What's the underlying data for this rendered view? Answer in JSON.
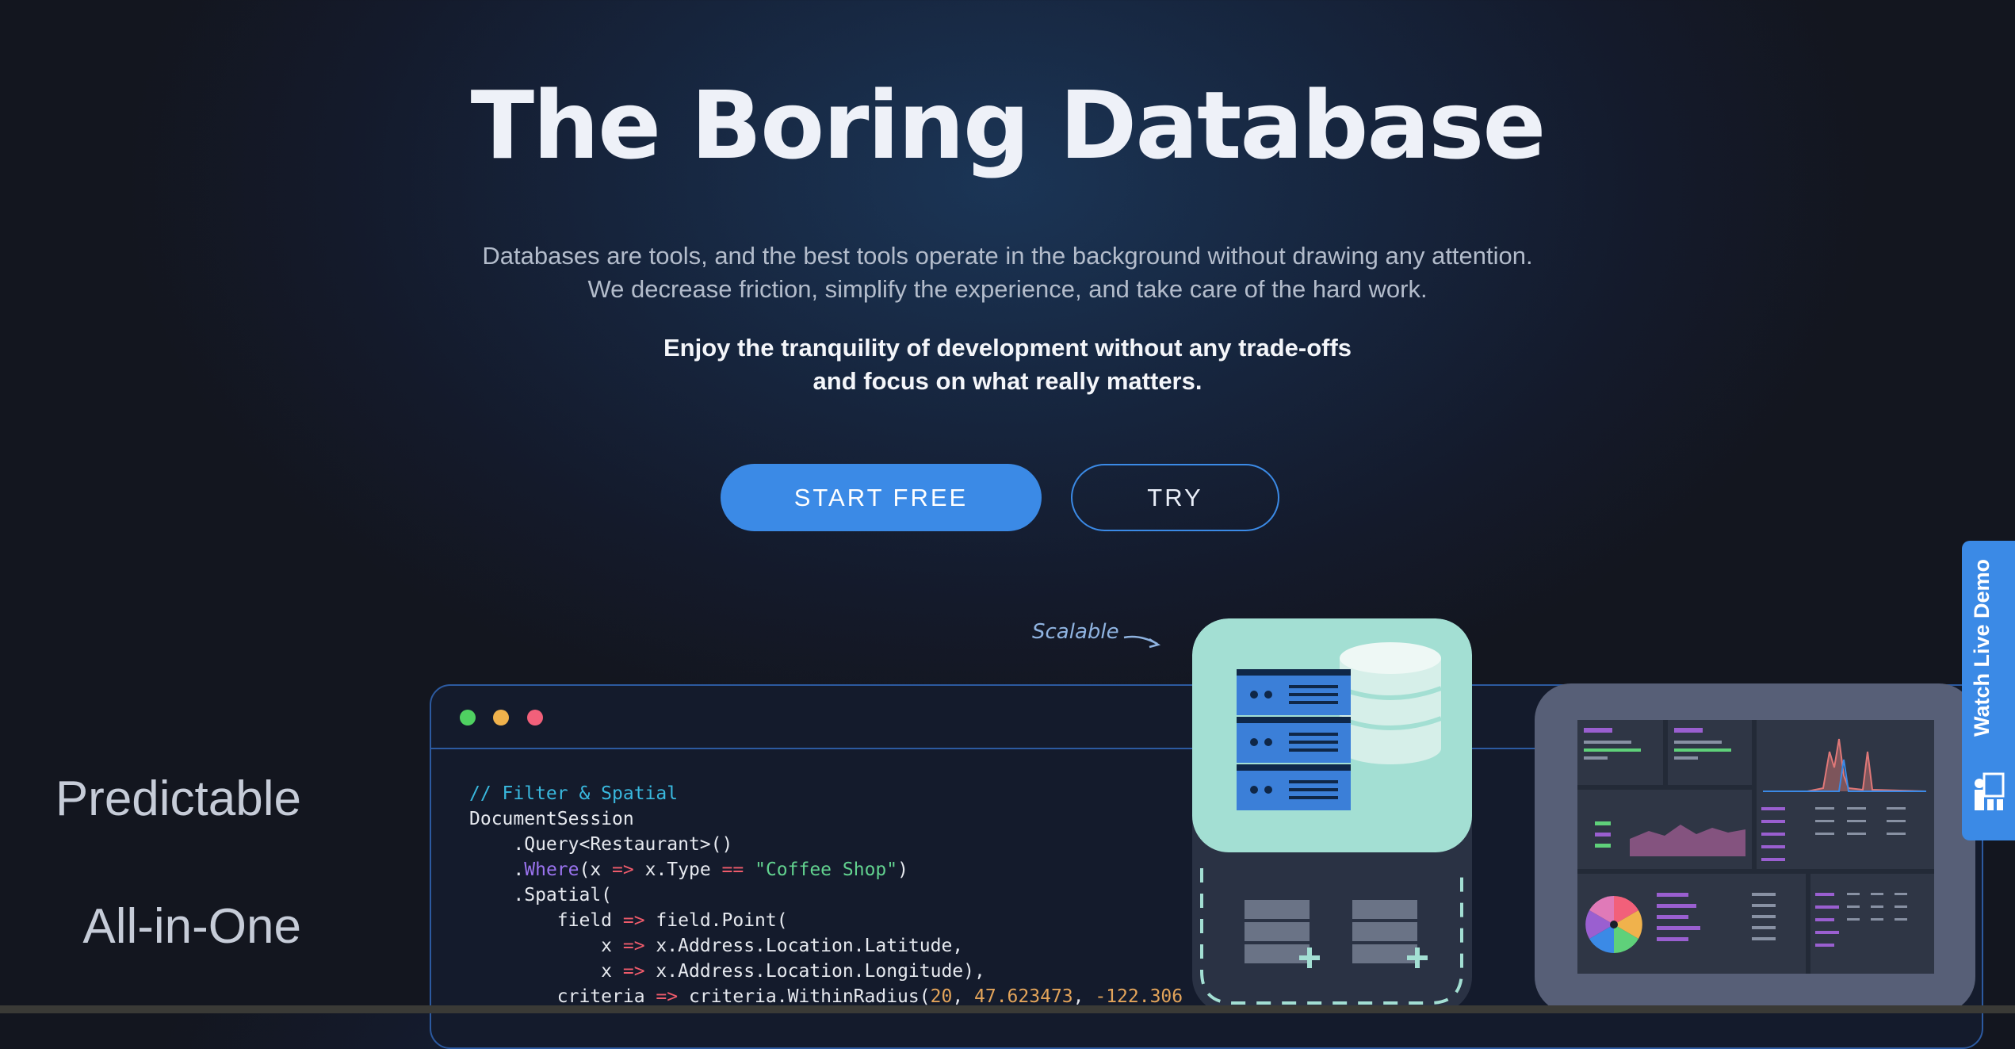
{
  "hero": {
    "title": "The Boring Database",
    "lead_line1": "Databases are tools, and the best tools operate in the background without drawing any attention.",
    "lead_line2": "We decrease friction, simplify the experience, and take care of the hard work.",
    "strong_line1": "Enjoy the tranquility of development without any trade-offs",
    "strong_line2": "and focus on what really matters."
  },
  "buttons": {
    "start_free": "START FREE",
    "try": "TRY"
  },
  "features": {
    "predictable": "Predictable",
    "all_in_one": "All-in-One",
    "scalable": "Scalable"
  },
  "code": {
    "comment": "// Filter & Spatial",
    "line2": "DocumentSession",
    "line3": "    .Query<Restaurant>()",
    "where_dot": "    .",
    "where_kw": "Where",
    "where_a": "(x ",
    "arrow": "=>",
    "where_b": " x.Type ",
    "eq": "==",
    "where_str": "\"Coffee Shop\"",
    "where_end": ")",
    "line5": "    .Spatial(",
    "line6_a": "        field ",
    "line6_b": " field.Point(",
    "line7_a": "            x ",
    "line7_b": " x.Address.Location.Latitude,",
    "line8_a": "            x ",
    "line8_b": " x.Address.Location.Longitude),",
    "line9_a": "        criteria ",
    "line9_b": " criteria.WithinRadius(",
    "num1": "20",
    "sep": ", ",
    "num2": "47.623473",
    "sep2": ", ",
    "num3": "-122.306"
  },
  "live_demo": {
    "label": "Watch Live Demo"
  },
  "colors": {
    "accent": "#3b8ae6",
    "teal": "#a3dfd3",
    "dot_green": "#4fd161",
    "dot_yellow": "#f0b24c",
    "dot_red": "#f2607a"
  }
}
